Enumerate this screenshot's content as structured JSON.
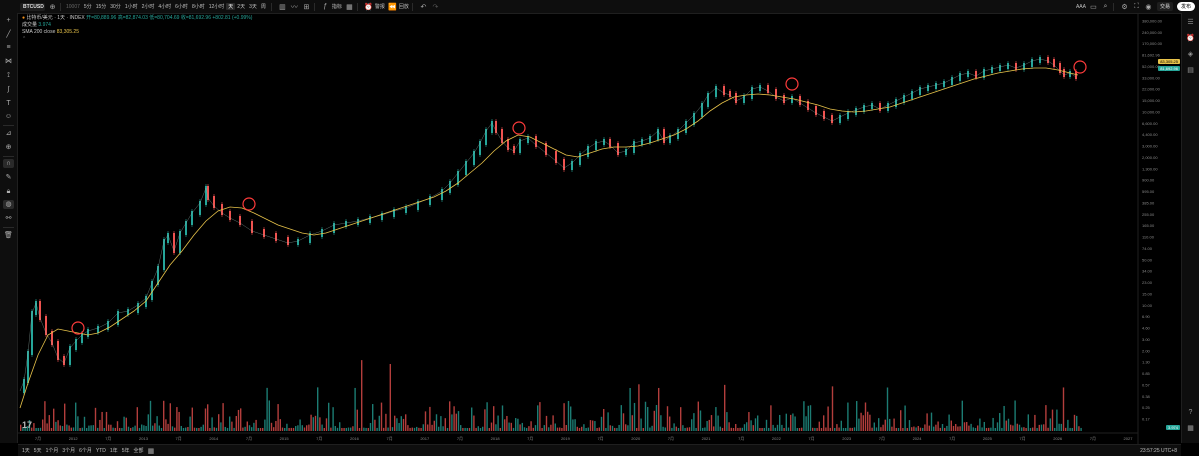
{
  "toolbar": {
    "symbol": "BTCUSD",
    "timeframes": [
      "10007",
      "5分",
      "15分",
      "30分",
      "1小时",
      "2小时",
      "4小时",
      "6小时",
      "8小时",
      "12小时",
      "天",
      "2天",
      "3天",
      "周"
    ],
    "active_timeframe": "天",
    "indicators_label": "指标",
    "alert_label": "警报",
    "replay_label": "回放",
    "layout_label": "AAA",
    "trade_label": "交易",
    "publish_label": "发布"
  },
  "legend": {
    "title": "比特币/美元 · 1天 · INDEX",
    "ohlc": "开=80,889.96 高=82,874.03 低=80,704.69 收=81,692.96 +802.81 (+0.99%)",
    "volume_label": "成交量",
    "volume_value": "3.974",
    "ma_label": "SMA 200 close",
    "ma_value": "83,305.25"
  },
  "price_axis": {
    "labels": [
      "380,000.00",
      "240,000.00",
      "170,000.00",
      "81,692.96",
      "52,000.00",
      "33,000.00",
      "22,000.00",
      "15,000.00",
      "10,000.00",
      "6,600.00",
      "4,400.00",
      "3,000.00",
      "2,000.00",
      "1,300.00",
      "900.00",
      "595.00",
      "385.00",
      "255.00",
      "165.00",
      "110.00",
      "74.00",
      "50.00",
      "34.00",
      "23.00",
      "15.00",
      "10.00",
      "6.90",
      "4.60",
      "3.00",
      "2.00",
      "1.30",
      "0.85",
      "0.57",
      "0.38",
      "0.25",
      "0.17"
    ],
    "current_price": "81,692.96",
    "ma_price": "83,305.25",
    "volume_tag": "3.974"
  },
  "time_axis": {
    "labels": [
      "7月",
      "2012",
      "7月",
      "2013",
      "7月",
      "2014",
      "7月",
      "2015",
      "7月",
      "2016",
      "7月",
      "2017",
      "7月",
      "2018",
      "7月",
      "2019",
      "7月",
      "2020",
      "7月",
      "2021",
      "7月",
      "2022",
      "7月",
      "2023",
      "7月",
      "2024",
      "7月",
      "2025",
      "7月",
      "2026",
      "7月",
      "2027"
    ]
  },
  "bottom": {
    "ranges": [
      "1天",
      "5天",
      "1个月",
      "3个月",
      "6个月",
      "YTD",
      "1年",
      "5年",
      "全部"
    ],
    "clock": "23:57:25 UTC+8"
  },
  "colors": {
    "up": "#26a69a",
    "down": "#ef5350",
    "ma": "#e8c34a",
    "circle": "#ff3b3b",
    "background": "#000000"
  }
}
